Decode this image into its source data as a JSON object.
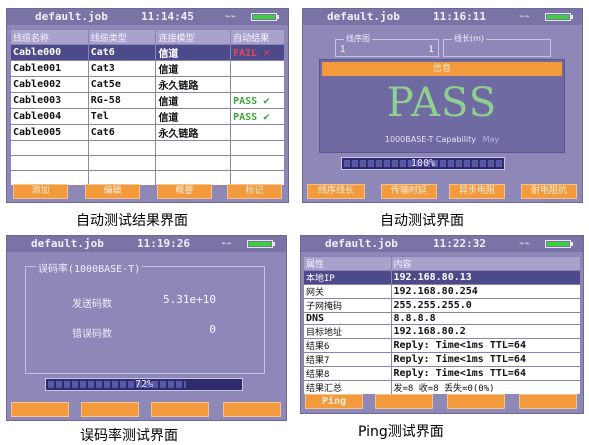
{
  "s1": {
    "file": "default.job",
    "time": "11:14:45",
    "headers": [
      "线缆名称",
      "线缆类型",
      "连接模型",
      "自动结果"
    ],
    "rows": [
      [
        "Cable000",
        "Cat6",
        "信道",
        "FAIL"
      ],
      [
        "Cable001",
        "Cat3",
        "信道",
        ""
      ],
      [
        "Cable002",
        "Cat5e",
        "永久链路",
        ""
      ],
      [
        "Cable003",
        "RG-58",
        "信道",
        "PASS"
      ],
      [
        "Cable004",
        "Tel",
        "信道",
        "PASS"
      ],
      [
        "Cable005",
        "Cat6",
        "永久链路",
        ""
      ]
    ],
    "buttons": [
      "添加",
      "编辑",
      "概要",
      "标记"
    ],
    "caption": "自动测试结果界面"
  },
  "s2": {
    "file": "default.job",
    "time": "11:16:11",
    "field1_label": "线序图",
    "field1_left": "1",
    "field1_right": "1",
    "field2_label": "线长(m)",
    "panel_header": "信息",
    "result": "PASS",
    "capability": "1000BASE-T Capability",
    "capability_note": "May",
    "progress_text": "100%",
    "progress": 1.0,
    "buttons": [
      "线序线长",
      "传输时延",
      "异步电阻",
      "耐电阻抗"
    ],
    "caption": "自动测试界面"
  },
  "s3": {
    "file": "default.job",
    "time": "11:19:26",
    "group_label": "误码率(1000BASE-T)",
    "rows": [
      {
        "label": "发送码数",
        "value": "5.31e+10"
      },
      {
        "label": "错误码数",
        "value": "0"
      }
    ],
    "progress_text": "72%",
    "progress": 0.72,
    "buttons": [
      "",
      "",
      "",
      ""
    ],
    "caption": "误码率测试界面"
  },
  "s4": {
    "file": "default.job",
    "time": "11:22:32",
    "headers": [
      "属性",
      "内容"
    ],
    "rows": [
      [
        "本地IP",
        "192.168.80.13"
      ],
      [
        "网关",
        "192.168.80.254"
      ],
      [
        "子网掩码",
        "255.255.255.0"
      ],
      [
        "DNS",
        "8.8.8.8"
      ],
      [
        "目标地址",
        "192.168.80.2"
      ],
      [
        "结果6",
        "Reply: Time<1ms TTL=64"
      ],
      [
        "结果7",
        "Reply: Time<1ms TTL=64"
      ],
      [
        "结果8",
        "Reply: Time<1ms TTL=64"
      ],
      [
        "结果汇总",
        "发=8 收=8 丢失=0(0%)"
      ]
    ],
    "buttons": [
      "Ping",
      "",
      "",
      ""
    ],
    "caption": "Ping测试界面"
  }
}
